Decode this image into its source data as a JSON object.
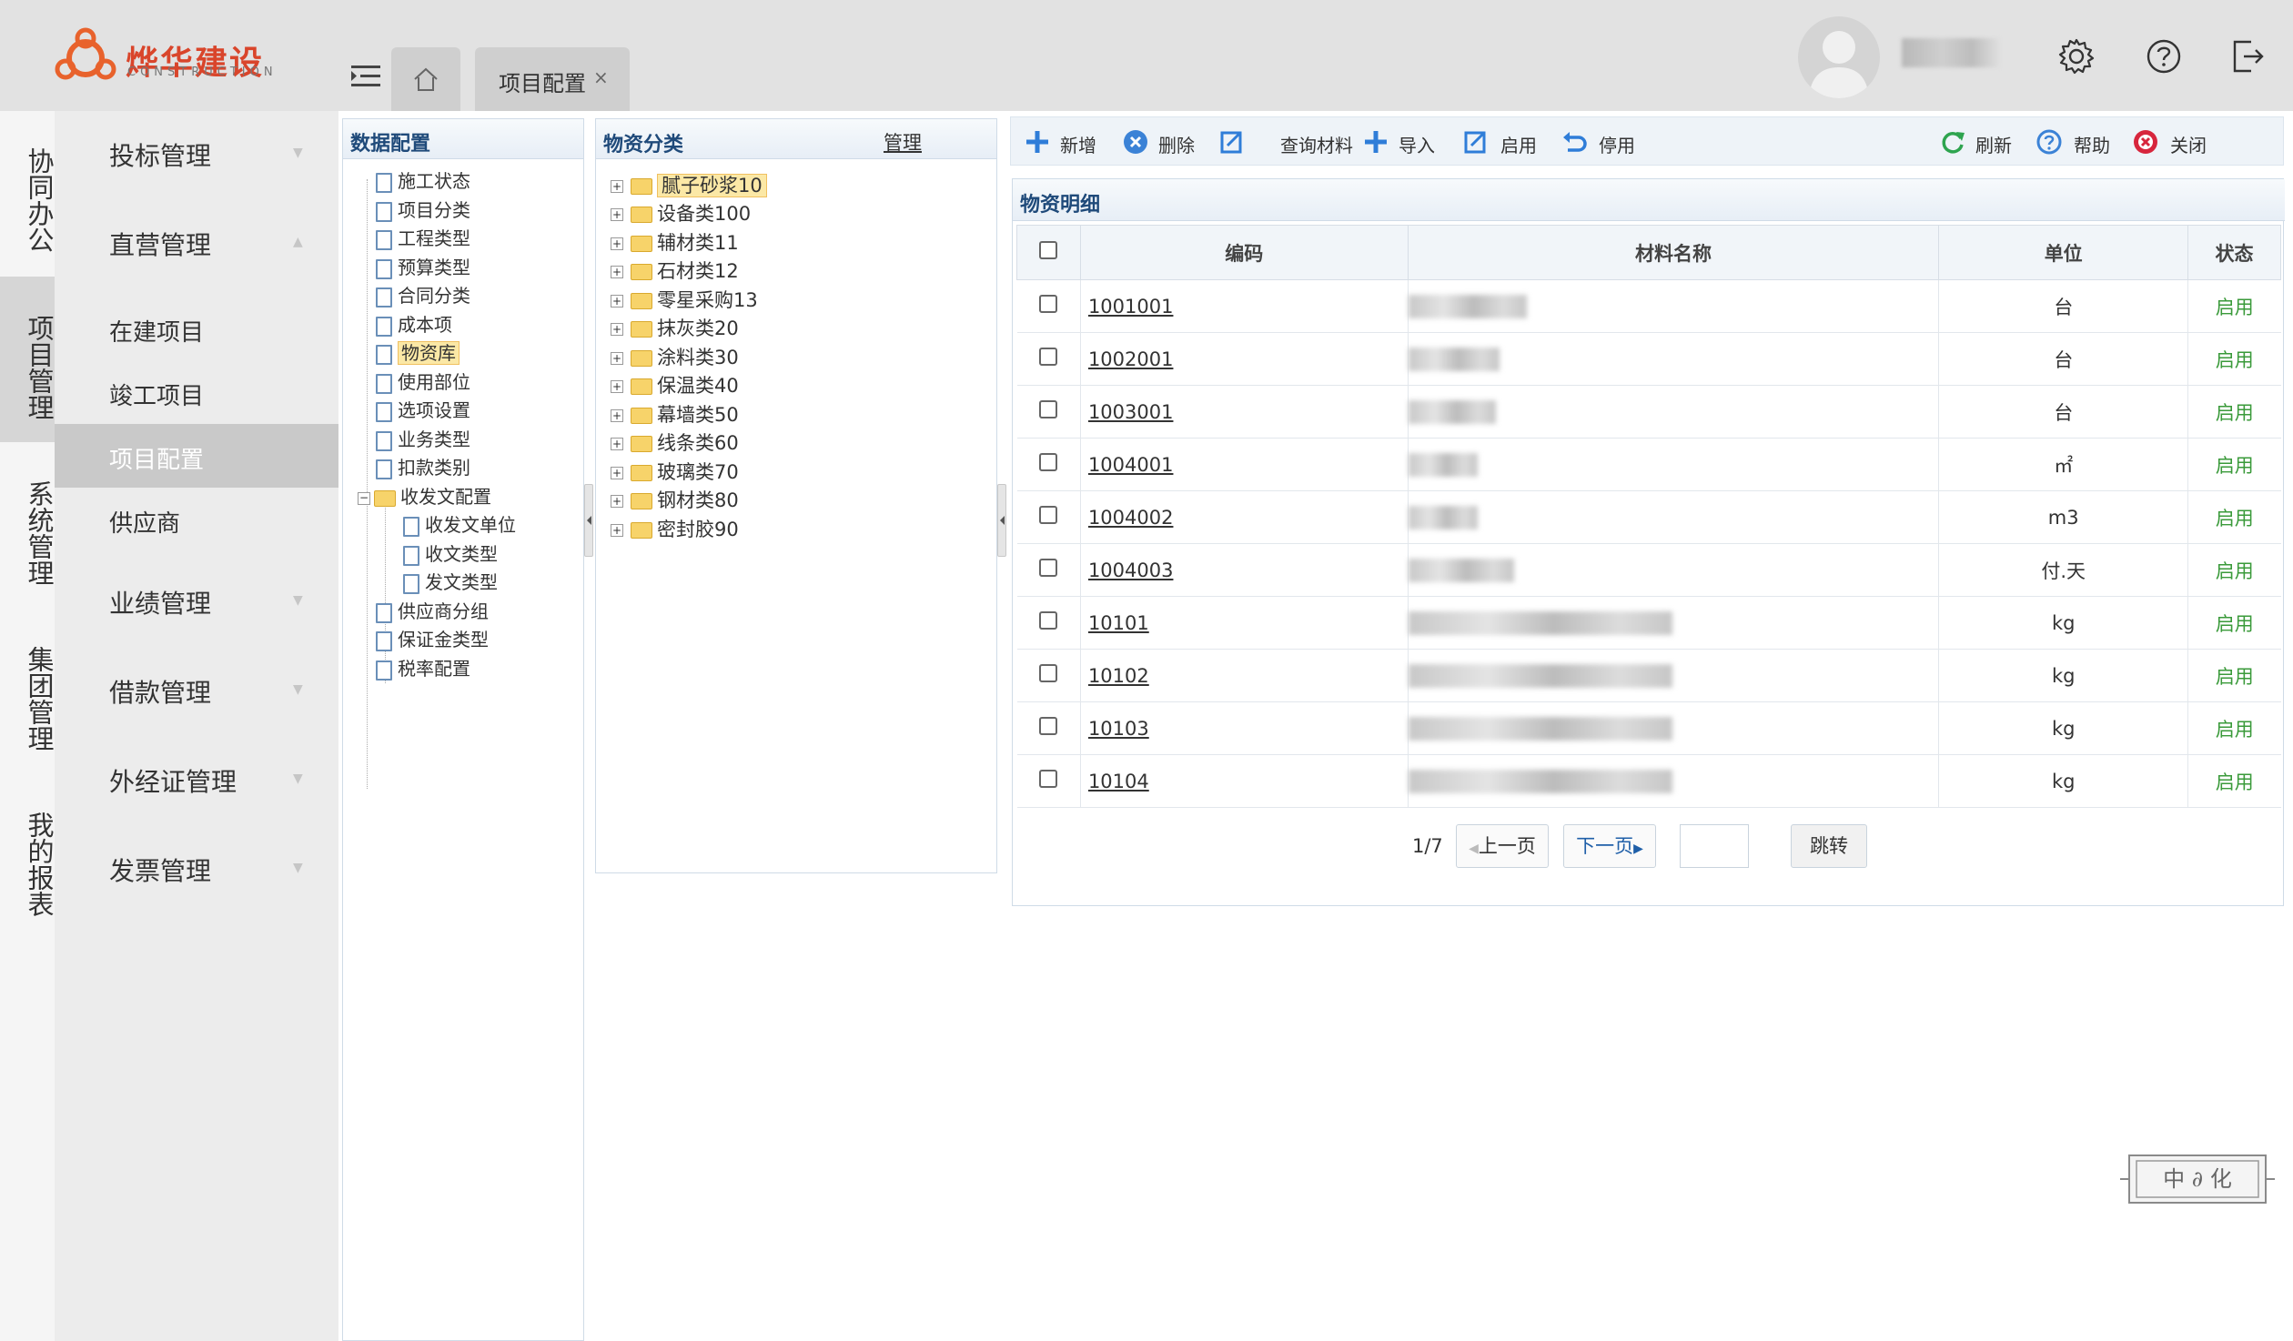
{
  "header": {
    "brand_name": "烨华建设",
    "brand_sub": "CONSTRUCTION",
    "tabs": [
      {
        "label": "项目配置",
        "close": "×"
      }
    ]
  },
  "left_bar": {
    "items": [
      {
        "label": "协同办公"
      },
      {
        "label": "项目管理"
      },
      {
        "label": "系统管理"
      },
      {
        "label": "集团管理"
      },
      {
        "label": "我的报表"
      }
    ]
  },
  "nav2": {
    "groups": [
      {
        "label": "投标管理"
      },
      {
        "label": "直营管理"
      },
      {
        "label": "业绩管理"
      },
      {
        "label": "借款管理"
      },
      {
        "label": "外经证管理"
      },
      {
        "label": "发票管理"
      }
    ],
    "sub_items": [
      {
        "label": "在建项目"
      },
      {
        "label": "竣工项目"
      },
      {
        "label": "项目配置"
      },
      {
        "label": "供应商"
      }
    ]
  },
  "data_config": {
    "title": "数据配置",
    "items": [
      {
        "label": "施工状态"
      },
      {
        "label": "项目分类"
      },
      {
        "label": "工程类型"
      },
      {
        "label": "预算类型"
      },
      {
        "label": "合同分类"
      },
      {
        "label": "成本项"
      },
      {
        "label": "物资库"
      },
      {
        "label": "使用部位"
      },
      {
        "label": "选项设置"
      },
      {
        "label": "业务类型"
      },
      {
        "label": "扣款类别"
      },
      {
        "label": "收发文配置"
      },
      {
        "label": "收发文单位"
      },
      {
        "label": "收文类型"
      },
      {
        "label": "发文类型"
      },
      {
        "label": "供应商分组"
      },
      {
        "label": "保证金类型"
      },
      {
        "label": "税率配置"
      }
    ]
  },
  "material_category": {
    "title": "物资分类",
    "manage_link": "管理",
    "items": [
      {
        "label": "腻子砂浆10"
      },
      {
        "label": "设备类100"
      },
      {
        "label": "辅材类11"
      },
      {
        "label": "石材类12"
      },
      {
        "label": "零星采购13"
      },
      {
        "label": "抹灰类20"
      },
      {
        "label": "涂料类30"
      },
      {
        "label": "保温类40"
      },
      {
        "label": "幕墙类50"
      },
      {
        "label": "线条类60"
      },
      {
        "label": "玻璃类70"
      },
      {
        "label": "钢材类80"
      },
      {
        "label": "密封胶90"
      }
    ]
  },
  "toolbar": {
    "add": "新增",
    "delete": "删除",
    "query": "查询材料",
    "import": "导入",
    "enable": "启用",
    "disable": "停用",
    "refresh": "刷新",
    "help": "帮助",
    "close": "关闭"
  },
  "detail": {
    "title": "物资明细",
    "columns": {
      "code": "编码",
      "name": "材料名称",
      "unit": "单位",
      "state": "状态"
    },
    "rows": [
      {
        "code": "1001001",
        "unit": "台",
        "state": "启用"
      },
      {
        "code": "1002001",
        "unit": "台",
        "state": "启用"
      },
      {
        "code": "1003001",
        "unit": "台",
        "state": "启用"
      },
      {
        "code": "1004001",
        "unit": "㎡",
        "state": "启用"
      },
      {
        "code": "1004002",
        "unit": "m3",
        "state": "启用"
      },
      {
        "code": "1004003",
        "unit": "付.天",
        "state": "启用"
      },
      {
        "code": "10101",
        "unit": "kg",
        "state": "启用"
      },
      {
        "code": "10102",
        "unit": "kg",
        "state": "启用"
      },
      {
        "code": "10103",
        "unit": "kg",
        "state": "启用"
      },
      {
        "code": "10104",
        "unit": "kg",
        "state": "启用"
      }
    ]
  },
  "pager": {
    "page_info": "1/7",
    "prev": "上一页",
    "next": "下一页",
    "jump": "跳转"
  },
  "seal": {
    "text": "中 ∂ 化"
  }
}
